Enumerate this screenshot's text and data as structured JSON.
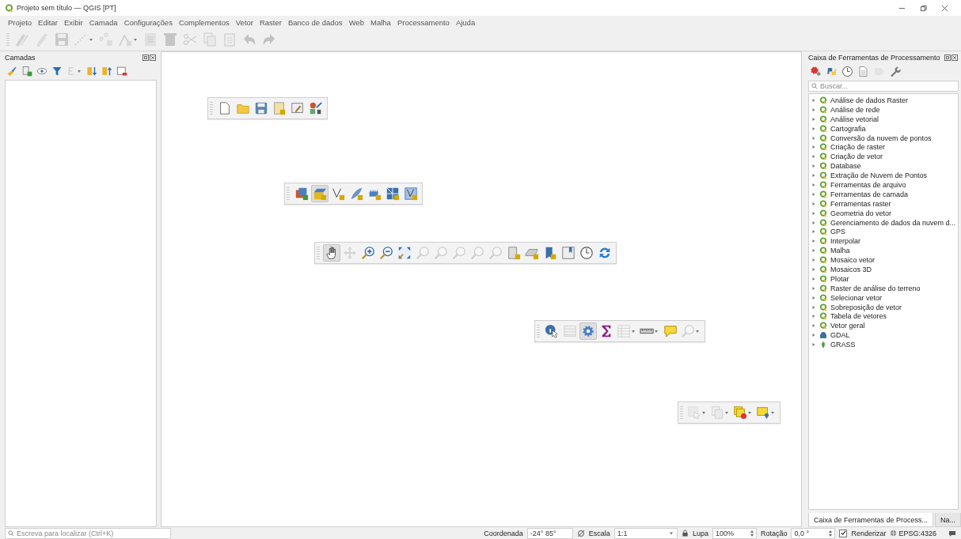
{
  "window": {
    "title": "Projeto sem título — QGIS [PT]"
  },
  "menu": [
    {
      "label": "Projeto"
    },
    {
      "label": "Editar"
    },
    {
      "label": "Exibir"
    },
    {
      "label": "Camada"
    },
    {
      "label": "Configurações"
    },
    {
      "label": "Complementos"
    },
    {
      "label": "Vetor"
    },
    {
      "label": "Raster"
    },
    {
      "label": "Banco de dados"
    },
    {
      "label": "Web"
    },
    {
      "label": "Malha"
    },
    {
      "label": "Processamento"
    },
    {
      "label": "Ajuda"
    }
  ],
  "main_toolbar": [
    {
      "kind": "pencils",
      "disabled": true,
      "dropdown": false
    },
    {
      "kind": "pencil",
      "disabled": true,
      "dropdown": false
    },
    {
      "kind": "floppy",
      "disabled": true,
      "dropdown": false
    },
    {
      "kind": "line",
      "disabled": true,
      "dropdown": true
    },
    {
      "kind": "points",
      "disabled": true,
      "dropdown": false
    },
    {
      "kind": "vertex",
      "disabled": true,
      "dropdown": true
    },
    {
      "kind": "notepad",
      "disabled": true,
      "dropdown": false
    },
    {
      "kind": "trash",
      "disabled": true,
      "dropdown": false
    },
    {
      "kind": "scissors",
      "disabled": true,
      "dropdown": false
    },
    {
      "kind": "copy",
      "disabled": true,
      "dropdown": false
    },
    {
      "kind": "paste",
      "disabled": true,
      "dropdown": false
    },
    {
      "kind": "undo",
      "disabled": true,
      "dropdown": false
    },
    {
      "kind": "redo",
      "disabled": true,
      "dropdown": false
    }
  ],
  "layers_panel": {
    "title": "Camadas",
    "toolbar": [
      {
        "kind": "brush",
        "disabled": false,
        "dropdown": false
      },
      {
        "kind": "addgroup",
        "disabled": false,
        "dropdown": false
      },
      {
        "kind": "eye",
        "disabled": false,
        "dropdown": false
      },
      {
        "kind": "filter",
        "disabled": false,
        "dropdown": false
      },
      {
        "kind": "epsilon",
        "disabled": true,
        "dropdown": true
      },
      {
        "kind": "expand",
        "disabled": false,
        "dropdown": false
      },
      {
        "kind": "collapse",
        "disabled": false,
        "dropdown": false
      },
      {
        "kind": "remove",
        "disabled": false,
        "dropdown": false
      }
    ]
  },
  "canvas_toolbars": [
    {
      "buttons": [
        {
          "kind": "document",
          "disabled": false,
          "dropdown": false,
          "selected": false
        },
        {
          "kind": "folder",
          "disabled": false,
          "dropdown": false,
          "selected": false
        },
        {
          "kind": "floppy",
          "disabled": false,
          "dropdown": false,
          "selected": false
        },
        {
          "kind": "layout",
          "disabled": false,
          "dropdown": false,
          "selected": false
        },
        {
          "kind": "layoutmanager",
          "disabled": false,
          "dropdown": false,
          "selected": false
        },
        {
          "kind": "style",
          "disabled": false,
          "dropdown": false,
          "selected": false
        }
      ]
    },
    {
      "buttons": [
        {
          "kind": "datasource",
          "disabled": false,
          "dropdown": false,
          "selected": false
        },
        {
          "kind": "box",
          "disabled": false,
          "dropdown": false,
          "selected": true
        },
        {
          "kind": "vshape",
          "disabled": false,
          "dropdown": false,
          "selected": false
        },
        {
          "kind": "feather",
          "disabled": false,
          "dropdown": false,
          "selected": false
        },
        {
          "kind": "chip",
          "disabled": false,
          "dropdown": false,
          "selected": false
        },
        {
          "kind": "grid",
          "disabled": false,
          "dropdown": false,
          "selected": false
        },
        {
          "kind": "vbox",
          "disabled": false,
          "dropdown": false,
          "selected": false
        }
      ]
    },
    {
      "buttons": [
        {
          "kind": "hand",
          "disabled": false,
          "dropdown": false,
          "selected": true
        },
        {
          "kind": "pan",
          "disabled": true,
          "dropdown": false,
          "selected": false
        },
        {
          "kind": "zoomin",
          "disabled": false,
          "dropdown": false,
          "selected": false
        },
        {
          "kind": "zoomout",
          "disabled": false,
          "dropdown": false,
          "selected": false
        },
        {
          "kind": "zoomfull",
          "disabled": false,
          "dropdown": false,
          "selected": false
        },
        {
          "kind": "magnifier",
          "disabled": true,
          "dropdown": false,
          "selected": false
        },
        {
          "kind": "magnifier",
          "disabled": true,
          "dropdown": false,
          "selected": false
        },
        {
          "kind": "magnifier",
          "disabled": true,
          "dropdown": false,
          "selected": false
        },
        {
          "kind": "magnifier",
          "disabled": true,
          "dropdown": false,
          "selected": false
        },
        {
          "kind": "magnifier",
          "disabled": true,
          "dropdown": false,
          "selected": false
        },
        {
          "kind": "mapview",
          "disabled": false,
          "dropdown": false,
          "selected": false
        },
        {
          "kind": "view3d",
          "disabled": false,
          "dropdown": false,
          "selected": false
        },
        {
          "kind": "bookmarknew",
          "disabled": false,
          "dropdown": false,
          "selected": false
        },
        {
          "kind": "bookmarks",
          "disabled": false,
          "dropdown": false,
          "selected": false
        },
        {
          "kind": "clock",
          "disabled": false,
          "dropdown": false,
          "selected": false
        },
        {
          "kind": "refresh",
          "disabled": false,
          "dropdown": false,
          "selected": false
        }
      ]
    },
    {
      "buttons": [
        {
          "kind": "info",
          "disabled": false,
          "dropdown": false,
          "selected": false
        },
        {
          "kind": "abacus",
          "disabled": true,
          "dropdown": false,
          "selected": false
        },
        {
          "kind": "gear",
          "disabled": false,
          "dropdown": false,
          "selected": true
        },
        {
          "kind": "sigma",
          "disabled": false,
          "dropdown": false,
          "selected": false
        },
        {
          "kind": "table",
          "disabled": true,
          "dropdown": true,
          "selected": false
        },
        {
          "kind": "ruler",
          "disabled": false,
          "dropdown": true,
          "selected": false
        },
        {
          "kind": "bubble",
          "disabled": false,
          "dropdown": false,
          "selected": false
        },
        {
          "kind": "magnifier",
          "disabled": true,
          "dropdown": true,
          "selected": false
        }
      ]
    },
    {
      "buttons": [
        {
          "kind": "select",
          "disabled": true,
          "dropdown": true,
          "selected": false
        },
        {
          "kind": "copy",
          "disabled": true,
          "dropdown": true,
          "selected": false
        },
        {
          "kind": "selectremove",
          "disabled": false,
          "dropdown": true,
          "selected": false
        },
        {
          "kind": "selectpin",
          "disabled": false,
          "dropdown": true,
          "selected": false
        }
      ]
    }
  ],
  "processing_panel": {
    "title": "Caixa de Ferramentas de Processamento",
    "toolbar": [
      {
        "kind": "redgear",
        "disabled": false,
        "dropdown": false
      },
      {
        "kind": "python",
        "disabled": false,
        "dropdown": false
      },
      {
        "kind": "clock",
        "disabled": false,
        "dropdown": false
      },
      {
        "kind": "results",
        "disabled": false,
        "dropdown": false
      },
      {
        "kind": "editinplace",
        "disabled": true,
        "dropdown": false
      },
      {
        "kind": "wrench",
        "disabled": false,
        "dropdown": false
      }
    ],
    "search": {
      "placeholder": "Buscar..."
    },
    "tree": [
      {
        "label": "Análise de dados Raster",
        "kind": "qgis",
        "expanded": false
      },
      {
        "label": "Análise de rede",
        "kind": "qgis",
        "expanded": false
      },
      {
        "label": "Análise vetorial",
        "kind": "qgis",
        "expanded": false
      },
      {
        "label": "Cartografia",
        "kind": "qgis",
        "expanded": false
      },
      {
        "label": "Conversão da nuvem de pontos",
        "kind": "qgis",
        "expanded": false
      },
      {
        "label": "Criação de raster",
        "kind": "qgis",
        "expanded": false
      },
      {
        "label": "Criação de vetor",
        "kind": "qgis",
        "expanded": false
      },
      {
        "label": "Database",
        "kind": "qgis",
        "expanded": false
      },
      {
        "label": "Extração de Nuvem de Pontos",
        "kind": "qgis",
        "expanded": false
      },
      {
        "label": "Ferramentas de arquivo",
        "kind": "qgis",
        "expanded": false
      },
      {
        "label": "Ferramentas de camada",
        "kind": "qgis",
        "expanded": false
      },
      {
        "label": "Ferramentas raster",
        "kind": "qgis",
        "expanded": false
      },
      {
        "label": "Geometria do vetor",
        "kind": "qgis",
        "expanded": false
      },
      {
        "label": "Gerenciamento de dados da nuvem d...",
        "kind": "qgis",
        "expanded": false
      },
      {
        "label": "GPS",
        "kind": "qgis",
        "expanded": false
      },
      {
        "label": "Interpolar",
        "kind": "qgis",
        "expanded": false
      },
      {
        "label": "Malha",
        "kind": "qgis",
        "expanded": false
      },
      {
        "label": "Mosaico vetor",
        "kind": "qgis",
        "expanded": false
      },
      {
        "label": "Mosaicos 3D",
        "kind": "qgis",
        "expanded": false
      },
      {
        "label": "Plotar",
        "kind": "qgis",
        "expanded": false
      },
      {
        "label": "Raster de análise do terreno",
        "kind": "qgis",
        "expanded": false
      },
      {
        "label": "Selecionar vetor",
        "kind": "qgis",
        "expanded": false
      },
      {
        "label": "Sobreposição de vetor",
        "kind": "qgis",
        "expanded": false
      },
      {
        "label": "Tabela de vetores",
        "kind": "qgis",
        "expanded": false
      },
      {
        "label": "Vetor geral",
        "kind": "qgis",
        "expanded": false
      },
      {
        "label": "GDAL",
        "kind": "gdal",
        "expanded": false
      },
      {
        "label": "GRASS",
        "kind": "grass",
        "expanded": false
      }
    ],
    "tabs": [
      {
        "label": "Caixa de Ferramentas de Process...",
        "selected": true
      },
      {
        "label": "Na...",
        "selected": false
      }
    ]
  },
  "status_bar": {
    "search": {
      "placeholder": "Escreva para localizar (Ctrl+K)"
    },
    "coordinate_label": "Coordenada",
    "coordinate": "-24° 85°",
    "scale_label": "Escala",
    "scale": "1:1",
    "magnifier_label": "Lupa",
    "magnifier": "100%",
    "rotation_label": "Rotação",
    "rotation": "0,0 °",
    "render": {
      "label": "Renderizar",
      "checked": true
    },
    "crs": "EPSG:4326"
  }
}
